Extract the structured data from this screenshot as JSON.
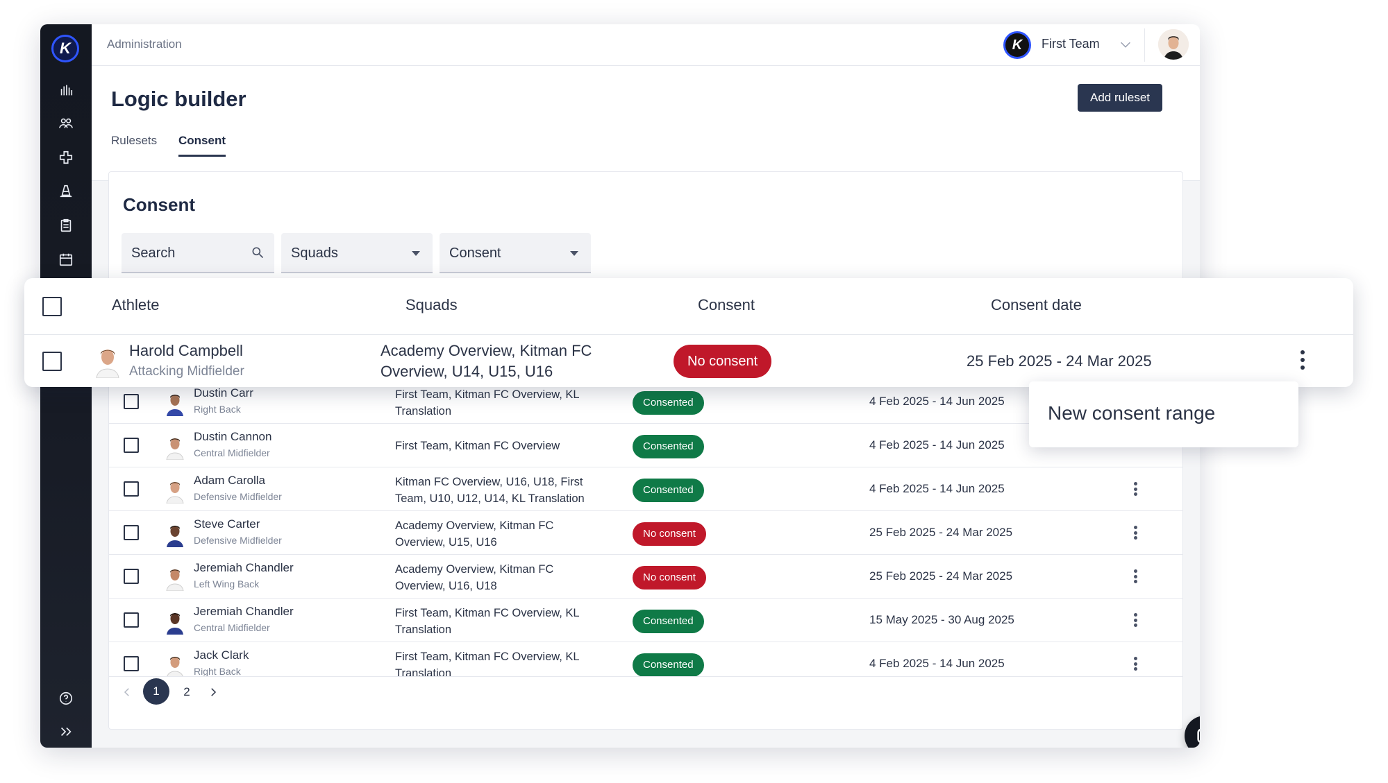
{
  "topbar": {
    "breadcrumb": "Administration",
    "team_name": "First Team"
  },
  "header": {
    "title": "Logic builder",
    "add_button": "Add ruleset",
    "tabs": [
      {
        "label": "Rulesets",
        "active": false
      },
      {
        "label": "Consent",
        "active": true
      }
    ]
  },
  "card": {
    "title": "Consent",
    "filters": {
      "search": "Search",
      "squads": "Squads",
      "consent": "Consent"
    }
  },
  "table": {
    "columns": [
      "Athlete",
      "Squads",
      "Consent",
      "Consent date"
    ],
    "highlighted_row": {
      "name": "Harold Campbell",
      "position": "Attacking Midfielder",
      "squads": "Academy Overview, Kitman FC Overview, U14, U15, U16",
      "consent": "No consent",
      "date": "25 Feb 2025 - 24 Mar 2025"
    },
    "rows": [
      {
        "name": "Dustin Carr",
        "position": "Right Back",
        "squads": "First Team, Kitman FC Overview, KL Translation",
        "consent": "Consented",
        "status": "green",
        "date": "4 Feb 2025 - 14 Jun 2025"
      },
      {
        "name": "Dustin Cannon",
        "position": "Central Midfielder",
        "squads": "First Team, Kitman FC Overview",
        "consent": "Consented",
        "status": "green",
        "date": "4 Feb 2025 - 14 Jun 2025"
      },
      {
        "name": "Adam Carolla",
        "position": "Defensive Midfielder",
        "squads": "Kitman FC Overview, U16, U18, First Team, U10, U12, U14, KL Translation",
        "consent": "Consented",
        "status": "green",
        "date": "4 Feb 2025 - 14 Jun 2025"
      },
      {
        "name": "Steve Carter",
        "position": "Defensive Midfielder",
        "squads": "Academy Overview, Kitman FC Overview, U15, U16",
        "consent": "No consent",
        "status": "red",
        "date": "25 Feb 2025 - 24 Mar 2025"
      },
      {
        "name": "Jeremiah Chandler",
        "position": "Left Wing Back",
        "squads": "Academy Overview, Kitman FC Overview, U16, U18",
        "consent": "No consent",
        "status": "red",
        "date": "25 Feb 2025 - 24 Mar 2025"
      },
      {
        "name": "Jeremiah Chandler",
        "position": "Central Midfielder",
        "squads": "First Team, Kitman FC Overview, KL Translation",
        "consent": "Consented",
        "status": "green",
        "date": "15 May 2025 - 30 Aug 2025"
      },
      {
        "name": "Jack Clark",
        "position": "Right Back",
        "squads": "First Team, Kitman FC Overview, KL Translation",
        "consent": "Consented",
        "status": "green",
        "date": "4 Feb 2025 - 14 Jun 2025"
      }
    ]
  },
  "pagination": {
    "current": "1",
    "next_page": "2"
  },
  "context_menu": {
    "item": "New consent range"
  },
  "colors": {
    "sidebar": "#141821",
    "primary_button": "#2a3650",
    "consented": "#0f7a47",
    "no_consent": "#c0182a"
  }
}
